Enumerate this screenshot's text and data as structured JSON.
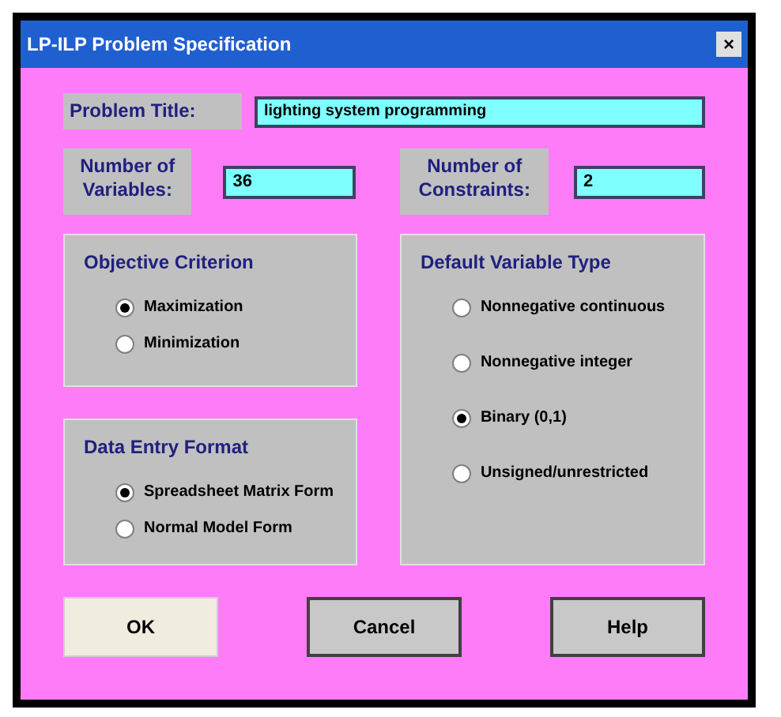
{
  "window": {
    "title": "LP-ILP Problem Specification",
    "close": "×"
  },
  "problem_title": {
    "label": "Problem Title:",
    "value": "lighting system programming"
  },
  "variables": {
    "label": "Number of Variables:",
    "value": "36"
  },
  "constraints": {
    "label": "Number of Constraints:",
    "value": "2"
  },
  "objective": {
    "title": "Objective Criterion",
    "options": [
      {
        "label": "Maximization",
        "selected": true
      },
      {
        "label": "Minimization",
        "selected": false
      }
    ]
  },
  "data_entry": {
    "title": "Data Entry Format",
    "options": [
      {
        "label": "Spreadsheet Matrix Form",
        "selected": true
      },
      {
        "label": "Normal Model Form",
        "selected": false
      }
    ]
  },
  "variable_type": {
    "title": "Default Variable Type",
    "options": [
      {
        "label": "Nonnegative continuous",
        "selected": false
      },
      {
        "label": "Nonnegative integer",
        "selected": false
      },
      {
        "label": "Binary (0,1)",
        "selected": true
      },
      {
        "label": "Unsigned/unrestricted",
        "selected": false
      }
    ]
  },
  "buttons": [
    {
      "label": "OK",
      "default": true
    },
    {
      "label": "Cancel",
      "default": false
    },
    {
      "label": "Help",
      "default": false
    }
  ]
}
